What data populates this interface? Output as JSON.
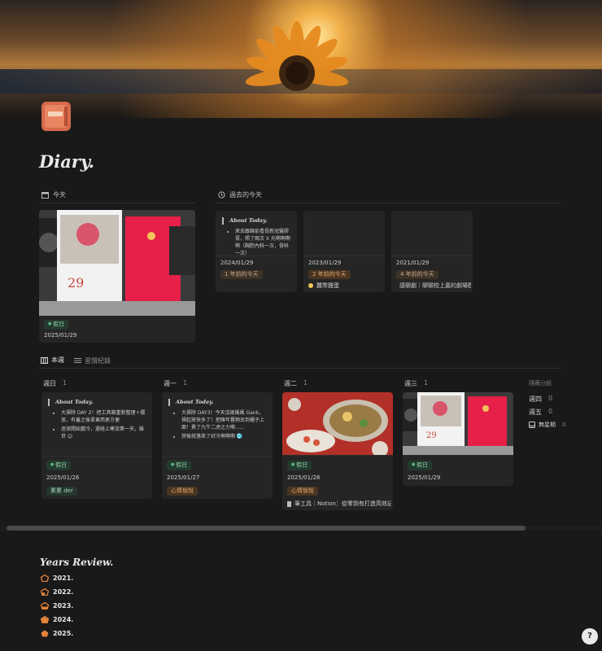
{
  "page": {
    "title": "Diary."
  },
  "today": {
    "label": "今天",
    "card": {
      "tag": "假日",
      "date": "2025/01/29"
    }
  },
  "past": {
    "label": "過去的今天",
    "cards": [
      {
        "preview_title": "About Today.",
        "preview_items": [
          "來去跟錦俞看長新冠醫膠膏，照了兩次 X 光啊啊啊啊（胸腔內科一次，骨科一次）"
        ],
        "date": "2024/01/29",
        "tag": "1 年前的今天",
        "extra": ""
      },
      {
        "preview_title": "",
        "preview_items": [],
        "date": "2023/01/29",
        "tag": "2 年前的今天",
        "extra": "蠶幣雞蛋"
      },
      {
        "preview_title": "",
        "preview_items": [],
        "date": "2021/01/29",
        "tag": "4 年前的今天",
        "extra": "語聊劇｜聊聊校上嘉的劇場模式"
      }
    ]
  },
  "tabs": [
    {
      "label": "本週"
    },
    {
      "label": "習慣紀錄"
    }
  ],
  "board": {
    "columns": [
      {
        "name": "週日",
        "count": "1",
        "card": {
          "preview_title": "About Today.",
          "preview_items": [
            "大掃除 DAY 2！把工具箱重新整理＋擺放，有蓋之後拿東西更方便",
            "逐漸開始變冷，還碰上寒流第一天，躲世 😊"
          ],
          "tag": "假日",
          "date": "2025/01/26",
          "mood": "累累 der"
        }
      },
      {
        "name": "週一",
        "count": "1",
        "card": {
          "preview_title": "About Today.",
          "preview_items": [
            "大掃除 DAY3！今天沒被媽媽 Gank，掃起來快多了！把陳年舊物丟到櫃子上面！費了九牛二虎之力啊......",
            "然後就落來了好冷啊啊啊 🥶"
          ],
          "tag": "假日",
          "date": "2025/01/27",
          "mood": "心情愉悅"
        }
      },
      {
        "name": "週二",
        "count": "1",
        "card": {
          "tag": "假日",
          "date": "2025/01/28",
          "mood": "心情愉悅",
          "extra": "筆工具｜Notion：從零到有打造高效記錄工"
        }
      },
      {
        "name": "週三",
        "count": "1",
        "card": {
          "tag": "假日",
          "date": "2025/01/29"
        }
      }
    ],
    "hidden": {
      "label": "隱藏分組",
      "items": [
        {
          "name": "週四",
          "count": "0"
        },
        {
          "name": "週五",
          "count": "0"
        },
        {
          "name": "無星期",
          "count": "0"
        }
      ]
    }
  },
  "years": {
    "title": "Years Review.",
    "items": [
      "2021.",
      "2022.",
      "2023.",
      "2024.",
      "2025."
    ]
  },
  "calendar_day": "29",
  "help_label": "?"
}
